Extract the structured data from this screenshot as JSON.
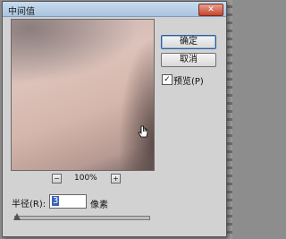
{
  "dialog": {
    "title": "中间值",
    "close_icon": "close-icon"
  },
  "buttons": {
    "ok": "确定",
    "cancel": "取消"
  },
  "preview": {
    "checkbox_label": "预览(P)",
    "checked": true,
    "check_mark": "✓"
  },
  "zoom": {
    "minus": "−",
    "plus": "+",
    "level": "100%"
  },
  "radius": {
    "label": "半径(R):",
    "value": "3",
    "unit": "像素",
    "slider_fraction": 0.02
  }
}
